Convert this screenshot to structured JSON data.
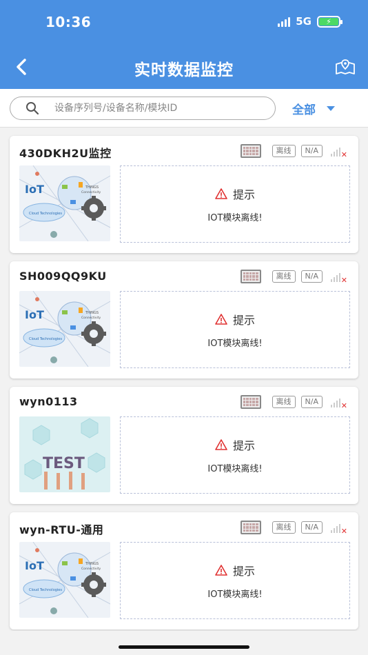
{
  "status_bar": {
    "time": "10:36",
    "network": "5G"
  },
  "header": {
    "title": "实时数据监控",
    "back_icon": "chevron-left-icon",
    "map_icon": "map-location-icon"
  },
  "search": {
    "placeholder": "设备序列号/设备名称/模块ID",
    "value": "",
    "filter_label": "全部"
  },
  "devices": [
    {
      "name": "430DKH2U监控",
      "status_tag": "离线",
      "na_tag": "N/A",
      "notice_title": "提示",
      "notice_message": "IOT模块离线!",
      "image": "iot-cloud"
    },
    {
      "name": "SH009QQ9KU",
      "status_tag": "离线",
      "na_tag": "N/A",
      "notice_title": "提示",
      "notice_message": "IOT模块离线!",
      "image": "iot-cloud"
    },
    {
      "name": "wyn0113",
      "status_tag": "离线",
      "na_tag": "N/A",
      "notice_title": "提示",
      "notice_message": "IOT模块离线!",
      "image": "test-hands"
    },
    {
      "name": "wyn-RTU-通用",
      "status_tag": "离线",
      "na_tag": "N/A",
      "notice_title": "提示",
      "notice_message": "IOT模块离线!",
      "image": "iot-cloud"
    }
  ],
  "iot_image_text": {
    "iot": "IoT",
    "cloud": "Cloud Technologies",
    "things": "THINGS",
    "connectivity": "Connectivity"
  },
  "test_image_text": {
    "word": "TEST"
  },
  "colors": {
    "header_blue": "#4a90e2",
    "warning_red": "#e03030",
    "battery_green": "#4cd964"
  }
}
